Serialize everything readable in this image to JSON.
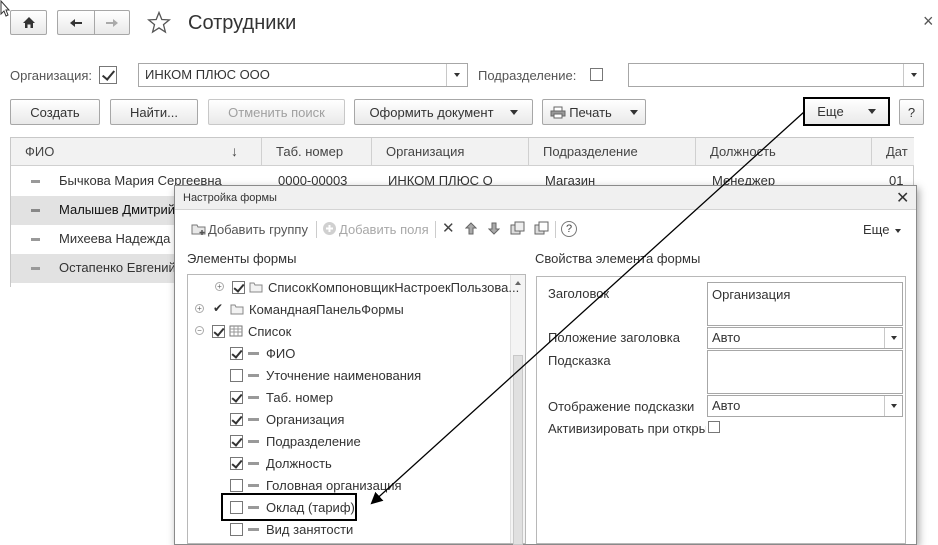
{
  "window": {
    "title": "Сотрудники",
    "close_symbol": "×"
  },
  "filters": {
    "org_label": "Организация:",
    "org_value": "ИНКОМ ПЛЮС ООО",
    "org_checked": true,
    "subdiv_label": "Подразделение:",
    "subdiv_checked": false,
    "subdiv_value": ""
  },
  "toolbar": {
    "create": "Создать",
    "find": "Найти...",
    "cancel_search": "Отменить поиск",
    "make_document": "Оформить документ",
    "print": "Печать",
    "more": "Еще",
    "help": "?"
  },
  "table": {
    "columns": [
      "ФИО",
      "Таб. номер",
      "Организация",
      "Подразделение",
      "Должность",
      "Дат"
    ],
    "sort_indicator": "↓",
    "rows": [
      {
        "name": "Бычкова Мария Сергеевна",
        "tab": "0000-00003",
        "org": "ИНКОМ ПЛЮС О",
        "subdiv": "Магазин",
        "position": "Менеджер",
        "date": "01"
      },
      {
        "name": "Малышев Дмитрий",
        "selected": true
      },
      {
        "name": "Михеева Надежда"
      },
      {
        "name": "Остапенко Евгений"
      }
    ]
  },
  "dialog": {
    "title": "Настройка формы",
    "toolbar": {
      "add_group": "Добавить группу",
      "add_fields": "Добавить поля",
      "help": "?",
      "more": "Еще"
    },
    "left_title": "Элементы формы",
    "right_title": "Свойства элемента формы",
    "tree": [
      {
        "label": "СписокКомпоновщикНастроекПользова...",
        "checked": true,
        "type": "folder",
        "expander": "plus"
      },
      {
        "label": "КоманднаяПанельФормы",
        "checked": true,
        "type": "folder",
        "expander": "plus"
      },
      {
        "label": "Список",
        "checked": true,
        "type": "table",
        "expander": "minus"
      },
      {
        "label": "ФИО",
        "checked": true,
        "type": "field"
      },
      {
        "label": "Уточнение наименования",
        "checked": false,
        "type": "field"
      },
      {
        "label": "Таб. номер",
        "checked": true,
        "type": "field"
      },
      {
        "label": "Организация",
        "checked": true,
        "type": "field"
      },
      {
        "label": "Подразделение",
        "checked": true,
        "type": "field"
      },
      {
        "label": "Должность",
        "checked": true,
        "type": "field"
      },
      {
        "label": "Головная организация",
        "checked": false,
        "type": "field"
      },
      {
        "label": "Оклад (тариф)",
        "checked": false,
        "type": "field",
        "highlighted": true
      },
      {
        "label": "Вид занятости",
        "checked": false,
        "type": "field"
      }
    ],
    "props": {
      "header_label": "Заголовок",
      "header_value": "Организация",
      "header_pos_label": "Положение заголовка",
      "header_pos_value": "Авто",
      "hint_label": "Подсказка",
      "hint_value": "",
      "hint_display_label": "Отображение подсказки",
      "hint_display_value": "Авто",
      "activate_label": "Активизировать при откры"
    }
  },
  "colors": {
    "accent_border": "#000000",
    "selected_row": "#e2e2e2",
    "header_bg": "#f2f2f2"
  }
}
